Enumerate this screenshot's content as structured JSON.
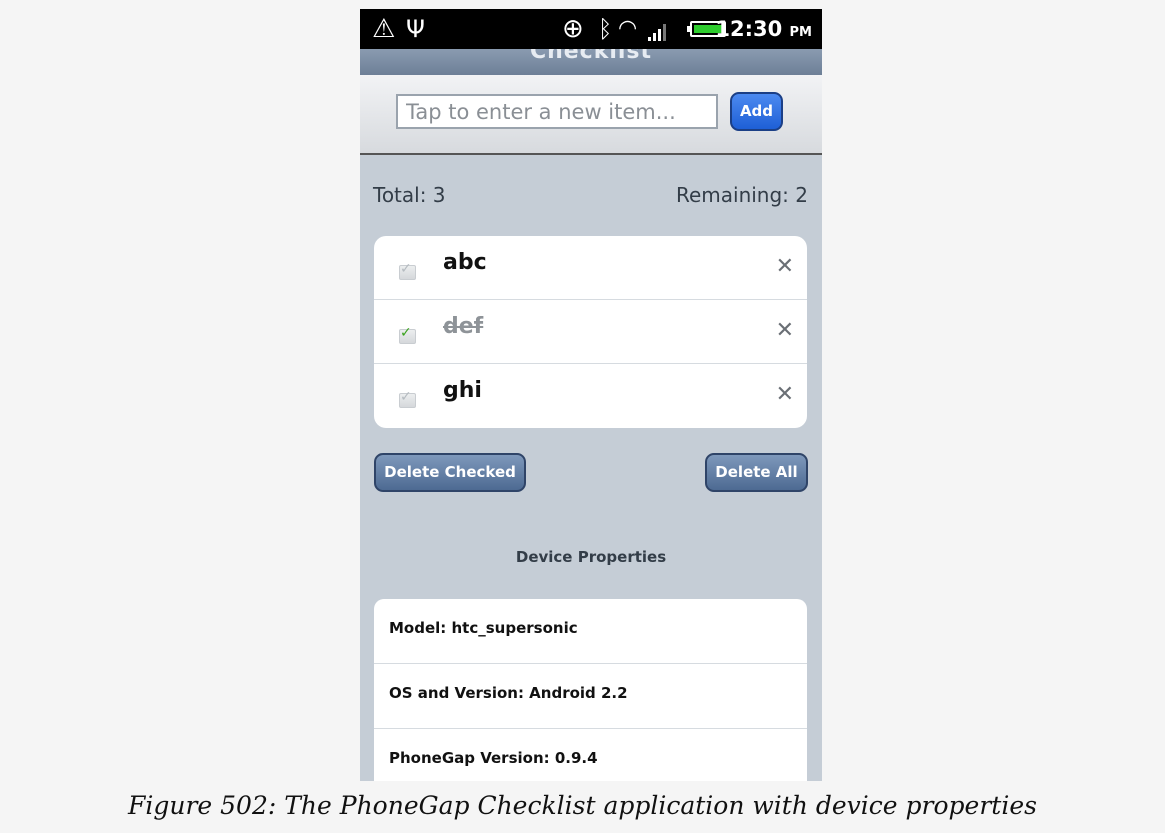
{
  "status_bar": {
    "time": "12:30",
    "ampm": "PM",
    "icons": [
      "alert-icon",
      "usb-icon",
      "gps-icon",
      "bluetooth-icon",
      "wifi-icon",
      "signal-icon",
      "battery-icon"
    ]
  },
  "header": {
    "title": "Checklist"
  },
  "new_item": {
    "placeholder": "Tap to enter a new item...",
    "add_label": "Add"
  },
  "counts": {
    "total": "Total: 3",
    "remaining": "Remaining: 2"
  },
  "items": [
    {
      "label": "abc",
      "checked": false
    },
    {
      "label": "def",
      "checked": true
    },
    {
      "label": "ghi",
      "checked": false
    }
  ],
  "actions": {
    "delete_checked": "Delete Checked",
    "delete_all": "Delete All"
  },
  "device": {
    "heading": "Device Properties",
    "properties": [
      "Model: htc_supersonic",
      "OS and Version: Android 2.2",
      "PhoneGap Version: 0.9.4"
    ]
  },
  "caption": "Figure 502: The PhoneGap Checklist application with device properties",
  "colors": {
    "accent_blue": "#1e5fd6",
    "button_slate": "#4d6a92",
    "background": "#c5cdd6",
    "check_green": "#3aa31d"
  }
}
